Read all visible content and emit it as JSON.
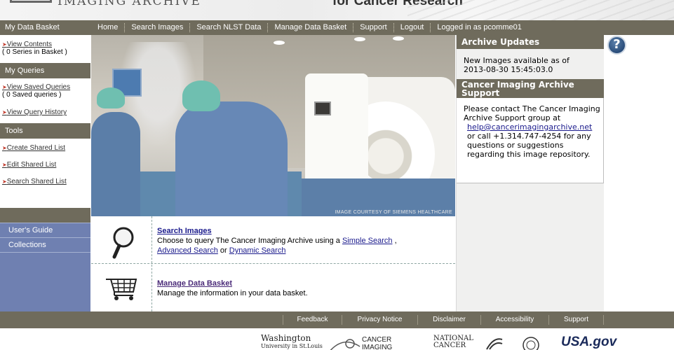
{
  "header": {
    "logo_text": "IMAGING ARCHIVE",
    "tagline": "for Cancer Research"
  },
  "nav": {
    "basket_title": "My Data Basket",
    "items": [
      "Home",
      "Search Images",
      "Search NLST Data",
      "Manage Data Basket",
      "Support",
      "Logout",
      "Logged in as pcomme01"
    ]
  },
  "sidebar": {
    "basket": {
      "view_contents": "View Contents",
      "series_count": "( 0 Series in Basket )"
    },
    "queries": {
      "title": "My Queries",
      "view_saved": "View Saved Queries",
      "saved_count": "( 0 Saved queries )",
      "view_history": "View Query History"
    },
    "tools": {
      "title": "Tools",
      "create_shared": "Create Shared List",
      "edit_shared": "Edit Shared List",
      "search_shared": "Search Shared List"
    },
    "users_guide": "User's Guide",
    "collections": "Collections"
  },
  "hero": {
    "credit": "IMAGE COURTESY OF SIEMENS HEALTHCARE"
  },
  "actions": {
    "search": {
      "title": "Search Images",
      "desc_prefix": "Choose to query The Cancer Imaging Archive using a",
      "simple": "Simple Search",
      "comma": ",",
      "advanced": "Advanced Search",
      "or": "or",
      "dynamic": "Dynamic Search"
    },
    "basket": {
      "title": "Manage Data Basket",
      "desc": "Manage the information in your data basket."
    }
  },
  "right": {
    "updates_title": "Archive Updates",
    "updates_line1": "New Images available as of",
    "updates_line2": "2013-08-30 15:45:03.0",
    "support_title_line1": "Cancer Imaging Archive",
    "support_title_line2": "Support",
    "support_text1": "Please contact The Cancer Imaging Archive Support group at",
    "support_email": "help@cancerimagingarchive.net",
    "support_text2": "or call +1.314.747-4254 for any questions or suggestions regarding this image repository."
  },
  "help_icon_glyph": "?",
  "footer": {
    "links": [
      "Feedback",
      "Privacy Notice",
      "Disclaimer",
      "Accessibility",
      "Support"
    ]
  },
  "logos": {
    "washu_line1": "Washington",
    "washu_line2": "University in St.Louis",
    "cancer_imaging_line1": "CANCER",
    "cancer_imaging_line2": "IMAGING",
    "nci_line1": "NATIONAL",
    "nci_line2": "CANCER",
    "usagov": "USA.gov"
  },
  "colors": {
    "bar": "#6f6b5c",
    "sidebar_blue": "#6f80b1",
    "link": "#1a1a8c"
  }
}
